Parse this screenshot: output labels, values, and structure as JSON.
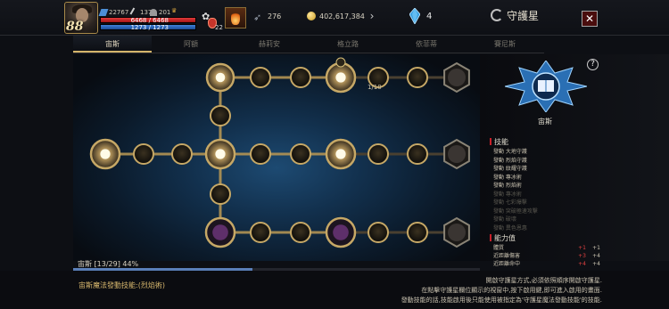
{
  "header": {
    "level": "88",
    "stat1": "22767",
    "stat2": "137",
    "stat3": "201",
    "hp": "6468 / 6468",
    "mp": "1273 / 1273",
    "potion_count": "22",
    "feathers": "276",
    "gold": "402,617,384",
    "crystals": "4",
    "window_title": "守護星",
    "close_label": "✕"
  },
  "tabs": [
    "宙斯",
    "阿額",
    "赫莉安",
    "格立路",
    "依菲蒂",
    "賽尼斯"
  ],
  "active_tab": 0,
  "tree": {
    "counter": "1/10"
  },
  "panel": {
    "god_name": "宙斯",
    "help": "?",
    "skills_title": "技能",
    "skills": [
      {
        "text": "發動 大地守護",
        "dim": false
      },
      {
        "text": "發動 烈焰守護",
        "dim": false
      },
      {
        "text": "發動 紋耀守護",
        "dim": false
      },
      {
        "text": "發動 專冰術",
        "dim": false
      },
      {
        "text": "發動 烈焰術",
        "dim": false
      },
      {
        "text": "發動 專冰術",
        "dim": true
      },
      {
        "text": "發動 七彩爆擊",
        "dim": true
      },
      {
        "text": "發動 突破極速攻擊",
        "dim": true
      },
      {
        "text": "發動 破壞",
        "dim": true
      },
      {
        "text": "發動 異色恩惠",
        "dim": true
      }
    ],
    "stats_title": "能力值",
    "stats": [
      {
        "name": "體質",
        "add": "+1",
        "total": "+1"
      },
      {
        "name": "近距離傷害",
        "add": "+3",
        "total": "+4"
      },
      {
        "name": "近距離命中",
        "add": "+4",
        "total": "+4"
      }
    ]
  },
  "progress": {
    "label": "宙斯 [13/29] 44%",
    "fraction": 0.44
  },
  "footer": {
    "active_skill": "宙斯魔法發動技能:(烈焰術)",
    "desc1": "開啟守護星方式,必須依照順序開啟守護星.",
    "desc2": "在點擊守護星欄位顯示的視窗中,按下啟用鍵,即可進入啟用的畫面.",
    "desc3": "發動技能的話,技能啟用後只能使用被指定為'守護星魔法發動技能'的技能."
  },
  "colors": {
    "accent_gold": "#d4b46a",
    "hp_red": "#c62828",
    "mp_blue": "#2f6bc0",
    "panel_red": "#c9202a"
  }
}
